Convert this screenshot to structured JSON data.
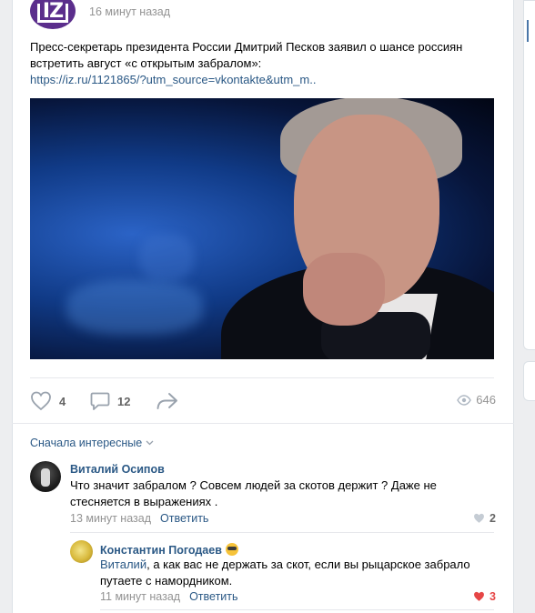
{
  "post": {
    "time": "16 минут назад",
    "text": "Пресс-секретарь президента России Дмитрий Песков заявил о шансе россиян встретить август «с открытым забралом»:",
    "link": "https://iz.ru/1121865/?utm_source=vkontakte&utm_m..",
    "avatar_text": "IZ",
    "avatar_color": "#5b2e8c"
  },
  "actions": {
    "likes": "4",
    "comments": "12",
    "views": "646",
    "icons": [
      "heart-icon",
      "comment-icon",
      "share-icon",
      "eye-icon"
    ]
  },
  "comments_sort": {
    "label": "Сначала интересные"
  },
  "comments": [
    {
      "author": "Виталий Осипов",
      "text": "Что значит забралом ? Совсем людей за скотов держит ? Даже не стесняется в выражениях .",
      "time": "13 минут назад",
      "reply_label": "Ответить",
      "likes": "2"
    },
    {
      "author": "Константин Погодаев",
      "author_emoji": "sunglasses-emoji",
      "reply_to": "Виталий",
      "text": ", а как вас не держать за скот, если вы рыцарское забрало путаете с намордником.",
      "time": "11 минут назад",
      "reply_label": "Ответить",
      "likes": "3",
      "liked": true
    }
  ],
  "colors": {
    "link": "#2a5885",
    "muted": "#939393",
    "liked": "#e64646",
    "background": "#edeef0"
  }
}
